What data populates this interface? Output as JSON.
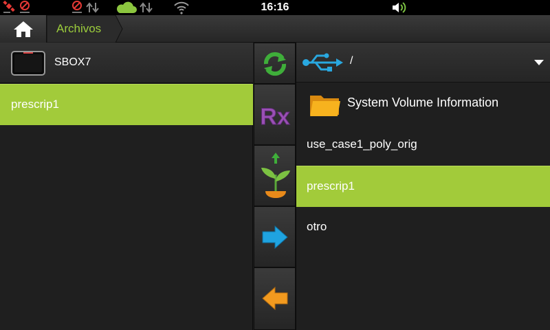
{
  "status_bar": {
    "time": "16:16",
    "icons": [
      "satellite-icon",
      "no-signal-icon",
      "no-connection-icon",
      "sync-arrows-icon",
      "cloud-icon",
      "cloud-sync-arrows-icon",
      "wifi-icon",
      "volume-icon"
    ],
    "colors": {
      "cloud": "#8cc63f",
      "alert": "#e53935",
      "volume": "#7cc242"
    }
  },
  "breadcrumb": {
    "home_icon": "home-icon",
    "current": "Archivos"
  },
  "left_panel": {
    "device": {
      "icon": "monitor-icon",
      "label": "SBOX7"
    },
    "items": [
      {
        "label": "prescrip1",
        "selected": true
      }
    ]
  },
  "toolbar": {
    "buttons": [
      {
        "name": "refresh-button",
        "icon": "refresh-icon"
      },
      {
        "name": "prescription-button",
        "icon": "rx-icon",
        "text": "Rx"
      },
      {
        "name": "seed-upload-button",
        "icon": "seedling-upload-icon"
      },
      {
        "name": "copy-right-button",
        "icon": "arrow-right-icon"
      },
      {
        "name": "copy-left-button",
        "icon": "arrow-left-icon"
      }
    ]
  },
  "right_panel": {
    "source": {
      "icon": "usb-icon",
      "path": "/"
    },
    "folders": [
      {
        "label": "System Volume Information"
      }
    ],
    "files": [
      {
        "label": "use_case1_poly_orig",
        "selected": false
      },
      {
        "label": "prescrip1",
        "selected": true
      },
      {
        "label": "otro",
        "selected": false
      }
    ]
  },
  "theme": {
    "accent": "#a2cb3a",
    "breadcrumb_text": "#9ccd3c"
  }
}
